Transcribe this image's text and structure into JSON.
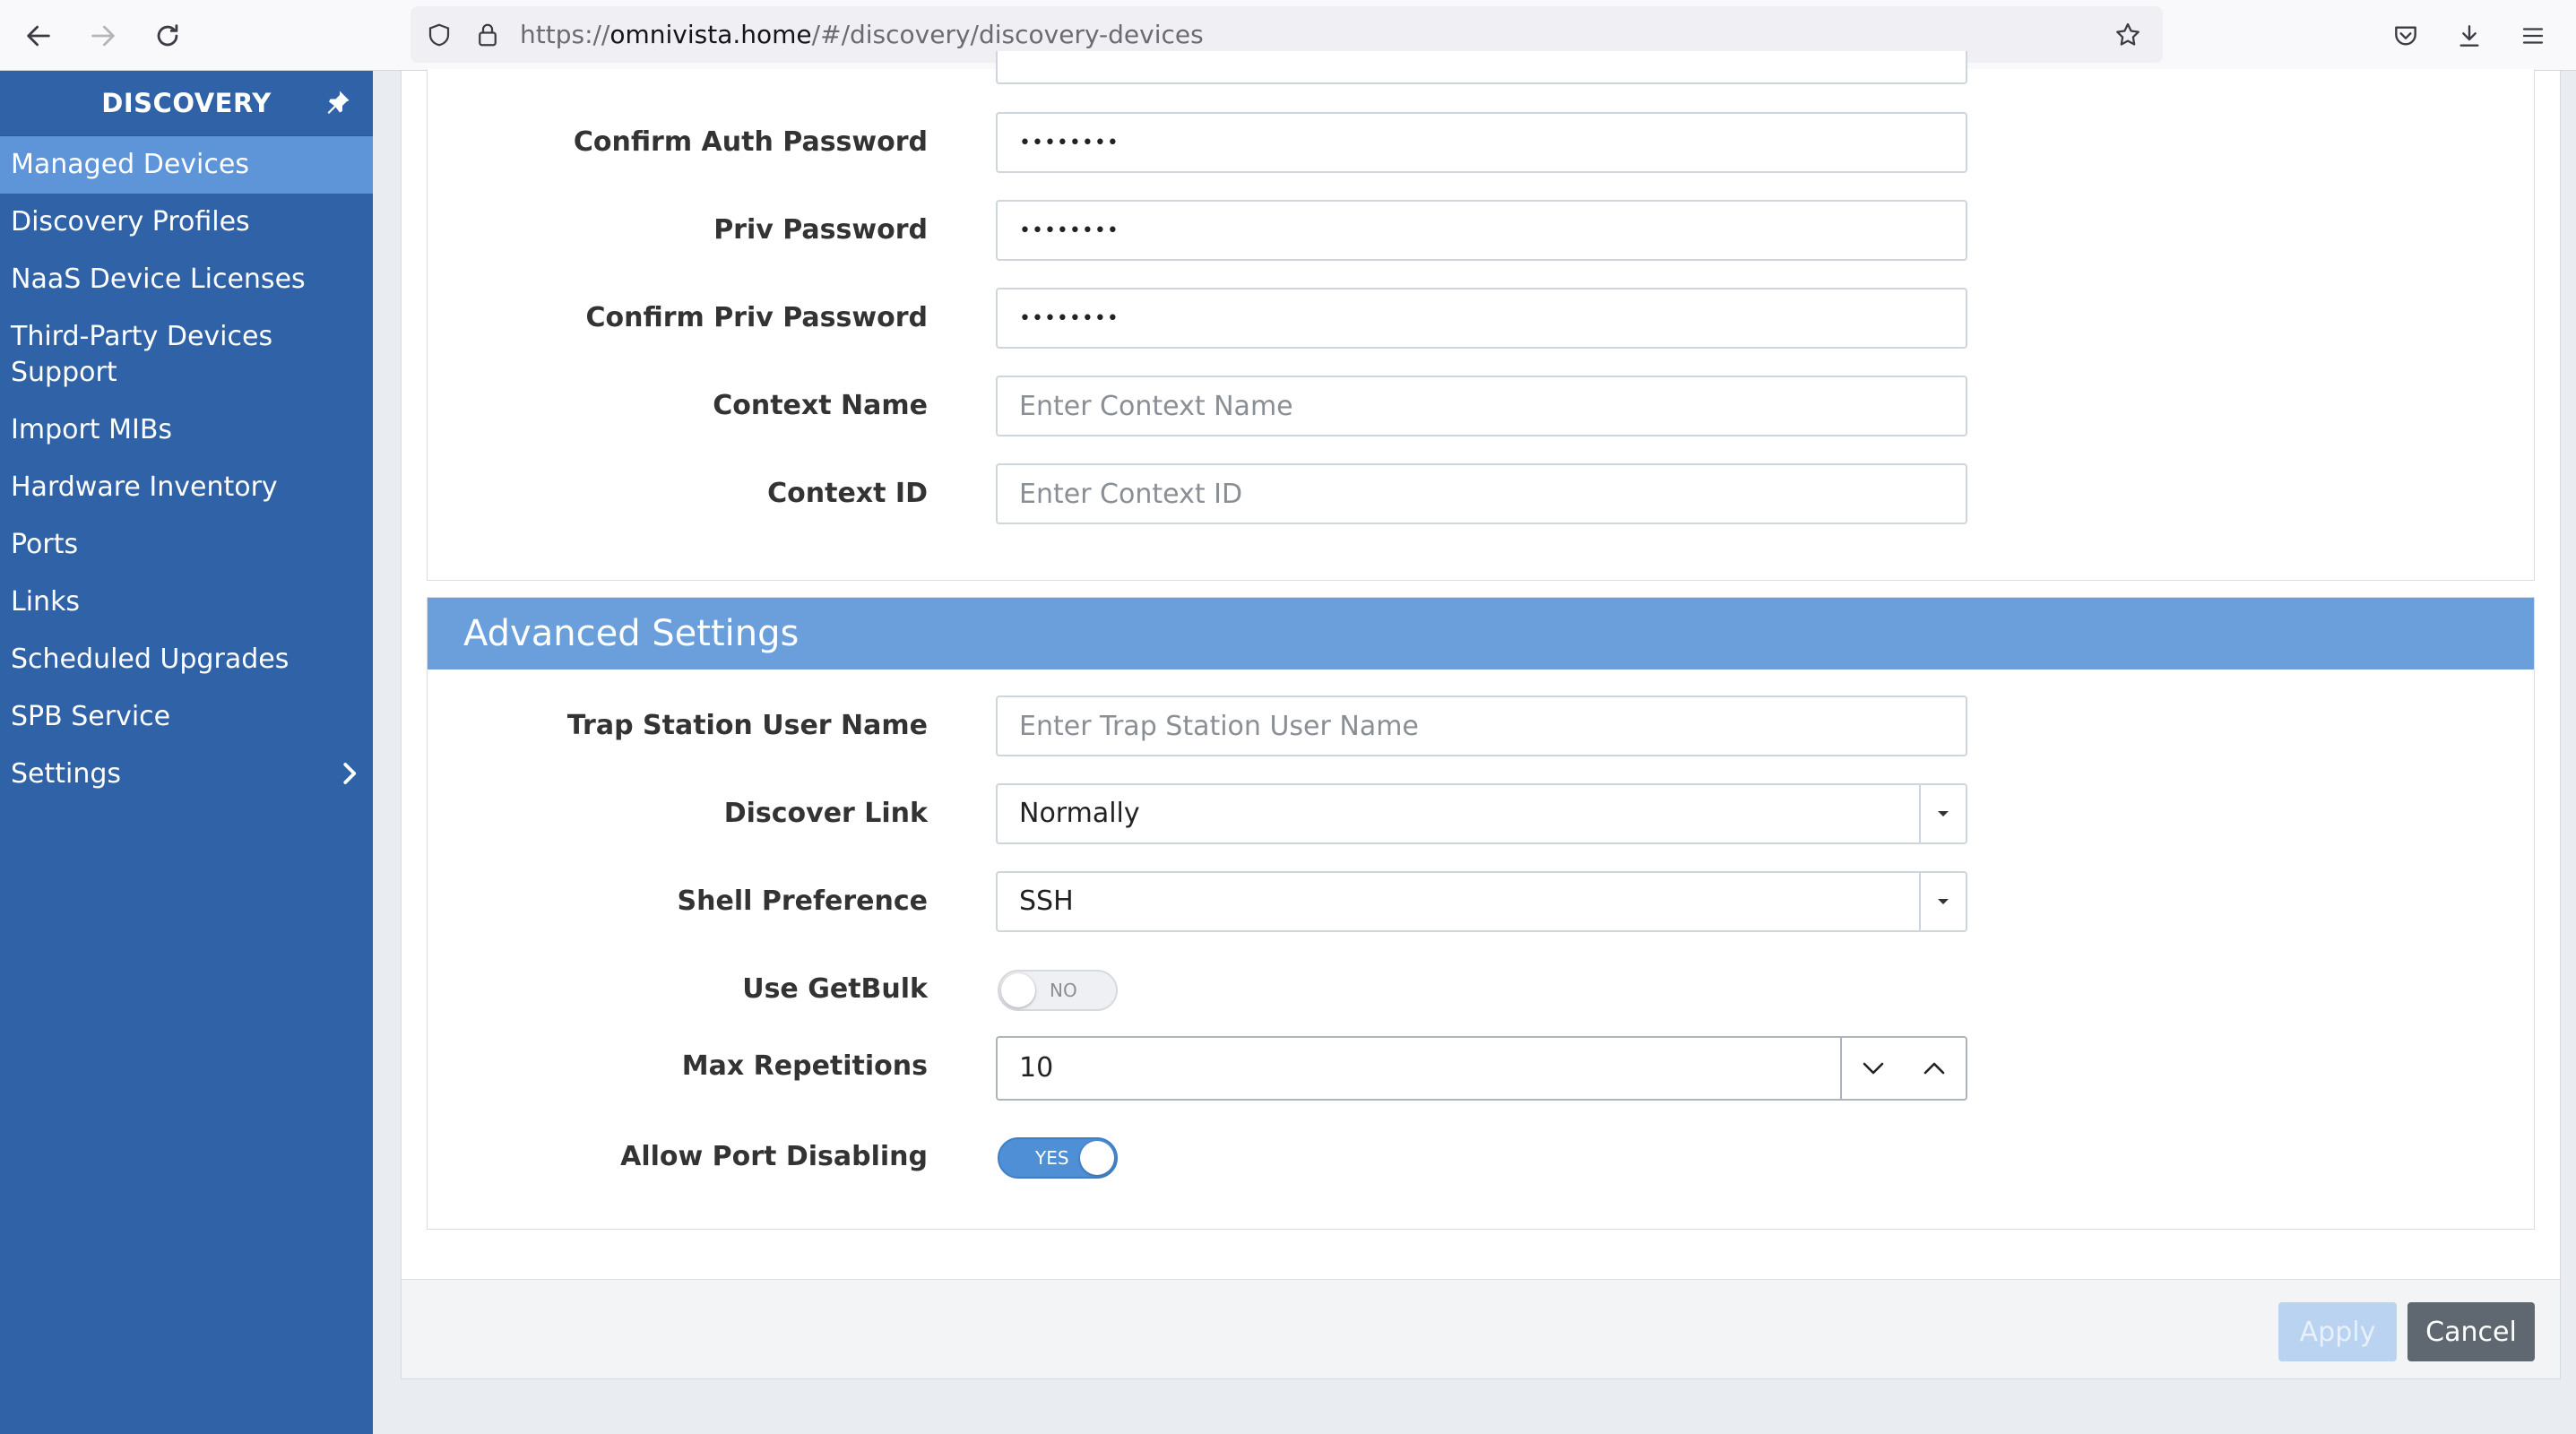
{
  "browser": {
    "url_scheme": "https://",
    "url_host": "omnivista.home",
    "url_path": "/#/discovery/discovery-devices"
  },
  "sidebar": {
    "title": "DISCOVERY",
    "items": [
      {
        "label": "Managed Devices",
        "active": true
      },
      {
        "label": "Discovery Profiles"
      },
      {
        "label": "NaaS Device Licenses"
      },
      {
        "label": "Third-Party Devices Support"
      },
      {
        "label": "Import MIBs"
      },
      {
        "label": "Hardware Inventory"
      },
      {
        "label": "Ports"
      },
      {
        "label": "Links"
      },
      {
        "label": "Scheduled Upgrades"
      },
      {
        "label": "SPB Service"
      },
      {
        "label": "Settings",
        "has_submenu": true
      }
    ]
  },
  "snmp": {
    "confirm_auth_password": {
      "label": "Confirm Auth Password",
      "value": "••••••••"
    },
    "priv_password": {
      "label": "Priv Password",
      "value": "••••••••"
    },
    "confirm_priv_password": {
      "label": "Confirm Priv Password",
      "value": "••••••••"
    },
    "context_name": {
      "label": "Context Name",
      "value": "",
      "placeholder": "Enter Context Name"
    },
    "context_id": {
      "label": "Context ID",
      "value": "",
      "placeholder": "Enter Context ID"
    }
  },
  "advanced": {
    "title": "Advanced Settings",
    "trap_station_user_name": {
      "label": "Trap Station User Name",
      "value": "",
      "placeholder": "Enter Trap Station User Name"
    },
    "discover_link": {
      "label": "Discover Link",
      "value": "Normally"
    },
    "shell_preference": {
      "label": "Shell Preference",
      "value": "SSH"
    },
    "use_getbulk": {
      "label": "Use GetBulk",
      "state": "NO"
    },
    "max_repetitions": {
      "label": "Max Repetitions",
      "value": "10"
    },
    "allow_port_disabling": {
      "label": "Allow Port Disabling",
      "state": "YES"
    }
  },
  "footer": {
    "apply_label": "Apply",
    "cancel_label": "Cancel"
  },
  "colors": {
    "sidebar_bg": "#2f62a7",
    "sidebar_active": "#5e95d8",
    "section_header": "#6a9fdb",
    "toggle_on": "#4e8fd6",
    "cancel_button": "#5f6770",
    "apply_button_disabled": "#b9d3f0"
  }
}
